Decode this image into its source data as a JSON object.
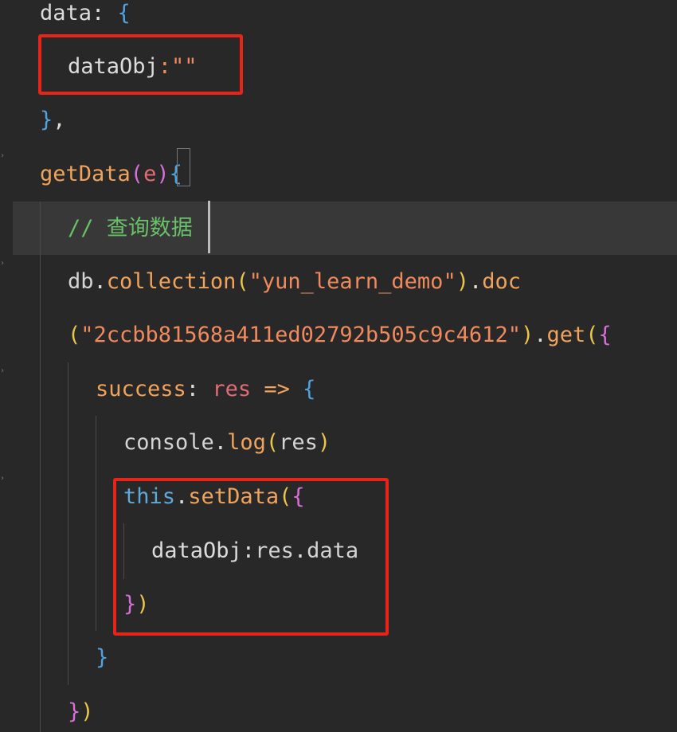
{
  "editor": {
    "lines": [
      {
        "id": "l1",
        "segments": [
          {
            "t": "data",
            "c": "prop"
          },
          {
            "t": ": ",
            "c": "punc"
          },
          {
            "t": "{",
            "c": "brace-b"
          }
        ]
      },
      {
        "id": "l2",
        "segments": [
          {
            "t": "dataObj",
            "c": "prop"
          },
          {
            "t": ":\"\"",
            "c": "str"
          }
        ]
      },
      {
        "id": "l3",
        "segments": [
          {
            "t": "}",
            "c": "brace-b"
          },
          {
            "t": ",",
            "c": "punc"
          }
        ]
      },
      {
        "id": "l4",
        "segments": [
          {
            "t": "getData",
            "c": "fn"
          },
          {
            "t": "(",
            "c": "brace-p"
          },
          {
            "t": "e",
            "c": "param"
          },
          {
            "t": ")",
            "c": "brace-p"
          },
          {
            "t": "{",
            "c": "brace-b"
          }
        ]
      },
      {
        "id": "l5",
        "segments": [
          {
            "t": "// 查询数据",
            "c": "comment"
          }
        ]
      },
      {
        "id": "l6",
        "segments": [
          {
            "t": "db",
            "c": "plain"
          },
          {
            "t": ".",
            "c": "punc"
          },
          {
            "t": "collection",
            "c": "fn"
          },
          {
            "t": "(",
            "c": "brace-y"
          },
          {
            "t": "\"yun_learn_demo\"",
            "c": "str"
          },
          {
            "t": ")",
            "c": "brace-y"
          },
          {
            "t": ".",
            "c": "punc"
          },
          {
            "t": "doc",
            "c": "fn"
          }
        ]
      },
      {
        "id": "l7",
        "segments": [
          {
            "t": "(",
            "c": "brace-y"
          },
          {
            "t": "\"2ccbb81568a411ed02792b505c9c4612\"",
            "c": "str"
          },
          {
            "t": ")",
            "c": "brace-y"
          },
          {
            "t": ".",
            "c": "punc"
          },
          {
            "t": "get",
            "c": "fn"
          },
          {
            "t": "(",
            "c": "brace-y"
          },
          {
            "t": "{",
            "c": "brace-p"
          }
        ]
      },
      {
        "id": "l8",
        "segments": [
          {
            "t": "success",
            "c": "fn"
          },
          {
            "t": ": ",
            "c": "punc"
          },
          {
            "t": "res",
            "c": "param"
          },
          {
            "t": " => ",
            "c": "fn"
          },
          {
            "t": "{",
            "c": "brace-b"
          }
        ]
      },
      {
        "id": "l9",
        "segments": [
          {
            "t": "console",
            "c": "plain"
          },
          {
            "t": ".",
            "c": "punc"
          },
          {
            "t": "log",
            "c": "fn"
          },
          {
            "t": "(",
            "c": "brace-y"
          },
          {
            "t": "res",
            "c": "plain"
          },
          {
            "t": ")",
            "c": "brace-y"
          }
        ]
      },
      {
        "id": "l10",
        "segments": [
          {
            "t": "this",
            "c": "kw"
          },
          {
            "t": ".",
            "c": "punc"
          },
          {
            "t": "setData",
            "c": "fn"
          },
          {
            "t": "(",
            "c": "brace-y"
          },
          {
            "t": "{",
            "c": "brace-p"
          }
        ]
      },
      {
        "id": "l11",
        "segments": [
          {
            "t": "dataObj",
            "c": "prop"
          },
          {
            "t": ":",
            "c": "punc"
          },
          {
            "t": "res",
            "c": "plain"
          },
          {
            "t": ".",
            "c": "punc"
          },
          {
            "t": "data",
            "c": "plain"
          }
        ]
      },
      {
        "id": "l12",
        "segments": [
          {
            "t": "}",
            "c": "brace-p"
          },
          {
            "t": ")",
            "c": "brace-y"
          }
        ]
      },
      {
        "id": "l13",
        "segments": [
          {
            "t": "}",
            "c": "brace-b"
          }
        ]
      },
      {
        "id": "l14",
        "segments": [
          {
            "t": "}",
            "c": "brace-p"
          },
          {
            "t": ")",
            "c": "brace-y"
          }
        ]
      }
    ]
  },
  "colors": {
    "background": "#282828",
    "highlight_box": "#e8231a",
    "current_line": "#383838"
  }
}
